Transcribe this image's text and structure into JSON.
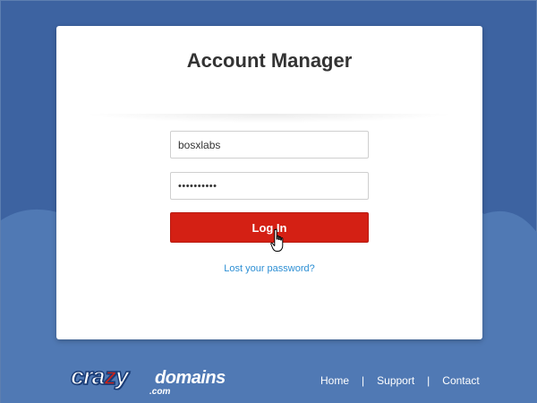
{
  "card": {
    "title": "Account Manager",
    "username_value": "bosxlabs",
    "password_value": "••••••••••",
    "login_label": "Log In",
    "lost_password_label": "Lost your password?"
  },
  "footer": {
    "logo_crazy_pre": "cra",
    "logo_crazy_z": "z",
    "logo_crazy_post": "y",
    "logo_domains": "domains",
    "logo_com": ".com",
    "nav": [
      "Home",
      "Support",
      "Contact"
    ],
    "separator": "|"
  },
  "colors": {
    "background": "#3d63a1",
    "cloud": "#5079b4",
    "button": "#d42014",
    "link": "#2d8fd4"
  },
  "icons": {
    "cursor": "hand-pointer-icon"
  }
}
